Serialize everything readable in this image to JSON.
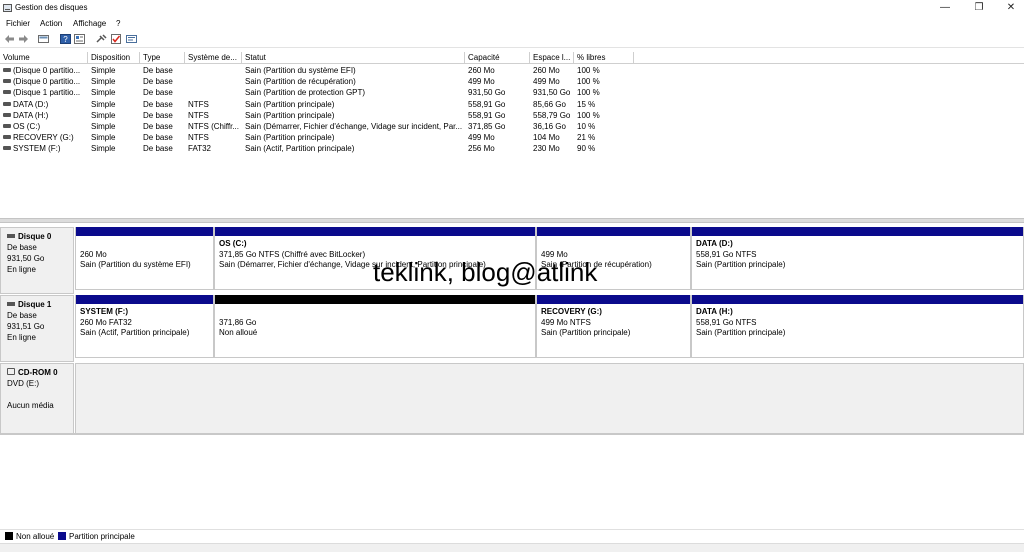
{
  "window": {
    "title": "Gestion des disques",
    "controls": {
      "minimize": "—",
      "maximize": "❐",
      "close": "✕"
    }
  },
  "menu": [
    "Fichier",
    "Action",
    "Affichage",
    "?"
  ],
  "toolbar": {
    "icons": [
      "back-arrow-icon",
      "forward-arrow-icon",
      "disk-list-icon",
      "help-icon",
      "properties-icon",
      "connect-icon",
      "check-icon",
      "settings-icon"
    ]
  },
  "volumes": {
    "headers": [
      "Volume",
      "Disposition",
      "Type",
      "Système de...",
      "Statut",
      "Capacité",
      "Espace l...",
      "% libres"
    ],
    "rows": [
      [
        "(Disque 0 partitio...",
        "Simple",
        "De base",
        "",
        "Sain (Partition du système EFI)",
        "260 Mo",
        "260 Mo",
        "100 %"
      ],
      [
        "(Disque 0 partitio...",
        "Simple",
        "De base",
        "",
        "Sain (Partition de récupération)",
        "499 Mo",
        "499 Mo",
        "100 %"
      ],
      [
        "(Disque 1 partitio...",
        "Simple",
        "De base",
        "",
        "Sain (Partition de protection GPT)",
        "931,50 Go",
        "931,50 Go",
        "100 %"
      ],
      [
        "DATA (D:)",
        "Simple",
        "De base",
        "NTFS",
        "Sain (Partition principale)",
        "558,91 Go",
        "85,66 Go",
        "15 %"
      ],
      [
        "DATA (H:)",
        "Simple",
        "De base",
        "NTFS",
        "Sain (Partition principale)",
        "558,91 Go",
        "558,79 Go",
        "100 %"
      ],
      [
        "OS (C:)",
        "Simple",
        "De base",
        "NTFS (Chiffr...",
        "Sain (Démarrer, Fichier d'échange, Vidage sur incident, Par...",
        "371,85 Go",
        "36,16 Go",
        "10 %"
      ],
      [
        "RECOVERY (G:)",
        "Simple",
        "De base",
        "NTFS",
        "Sain (Partition principale)",
        "499 Mo",
        "104 Mo",
        "21 %"
      ],
      [
        "SYSTEM (F:)",
        "Simple",
        "De base",
        "FAT32",
        "Sain (Actif, Partition principale)",
        "256 Mo",
        "230 Mo",
        "90 %"
      ]
    ]
  },
  "disks": [
    {
      "name": "Disque 0",
      "type": "De base",
      "size": "931,50 Go",
      "state": "En ligne",
      "partitions": [
        {
          "name": "",
          "line1": "260 Mo",
          "line2": "Sain (Partition du système EFI)",
          "kind": "primary"
        },
        {
          "name": "OS  (C:)",
          "line1": "371,85 Go NTFS (Chiffré avec BitLocker)",
          "line2": "Sain (Démarrer, Fichier d'échange, Vidage sur incident, Partition principale)",
          "kind": "primary"
        },
        {
          "name": "",
          "line1": "499 Mo",
          "line2": "Sain (Partition de récupération)",
          "kind": "primary"
        },
        {
          "name": "DATA  (D:)",
          "line1": "558,91 Go NTFS",
          "line2": "Sain (Partition principale)",
          "kind": "primary"
        }
      ]
    },
    {
      "name": "Disque 1",
      "type": "De base",
      "size": "931,51 Go",
      "state": "En ligne",
      "partitions": [
        {
          "name": "SYSTEM  (F:)",
          "line1": "260 Mo FAT32",
          "line2": "Sain (Actif, Partition principale)",
          "kind": "primary"
        },
        {
          "name": "",
          "line1": "371,86 Go",
          "line2": "Non alloué",
          "kind": "unalloc"
        },
        {
          "name": "RECOVERY  (G:)",
          "line1": "499 Mo NTFS",
          "line2": "Sain (Partition principale)",
          "kind": "primary"
        },
        {
          "name": "DATA  (H:)",
          "line1": "558,91 Go NTFS",
          "line2": "Sain (Partition principale)",
          "kind": "primary"
        }
      ]
    },
    {
      "name": "CD-ROM 0",
      "type": "DVD (E:)",
      "size": "",
      "state": "Aucun média"
    }
  ],
  "watermark": "teklink, blog@atlink",
  "legend": {
    "unalloc_label": "Non alloué",
    "primary_label": "Partition principale",
    "colors": {
      "unalloc": "#000000",
      "primary": "#0a0a8c"
    }
  }
}
